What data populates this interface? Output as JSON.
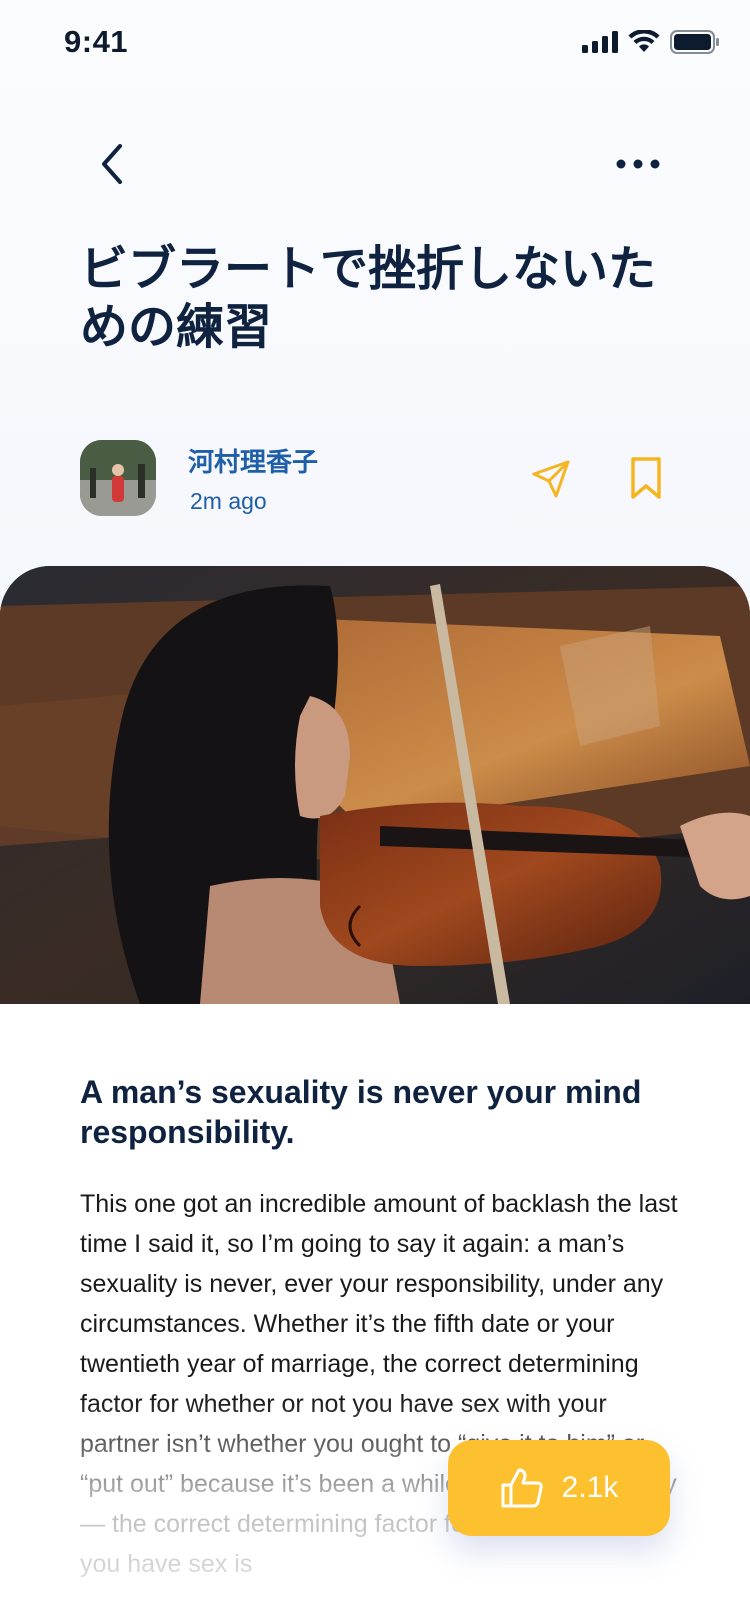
{
  "status_bar": {
    "time": "9:41"
  },
  "header": {
    "back_icon": "chevron-left-icon",
    "more_icon": "ellipsis-icon"
  },
  "article": {
    "title": "ビブラートで挫折しないための練習",
    "author": "河村理香子",
    "time_ago": "2m ago",
    "headline": "A man’s sexuality is never your mind responsibility.",
    "body": "This one got an incredible amount of backlash the last time I said it, so I’m going to say it again: a man’s sexuality is never, ever your responsibility, under any circumstances. Whether it’s the fifth date or your twentieth year of marriage, the correct determining factor for whether or not you have sex with your partner isn’t whether you ought to “give it to him” or “put out” because it’s been a while or he’s really horny — the correct determining factor for whether or not you have sex is"
  },
  "actions": {
    "share_icon": "send-icon",
    "bookmark_icon": "bookmark-icon"
  },
  "like": {
    "count": "2.1k",
    "icon": "thumbs-up-icon"
  },
  "colors": {
    "accent": "#fdc02e",
    "title": "#0f2340",
    "link": "#1f5fa8"
  }
}
